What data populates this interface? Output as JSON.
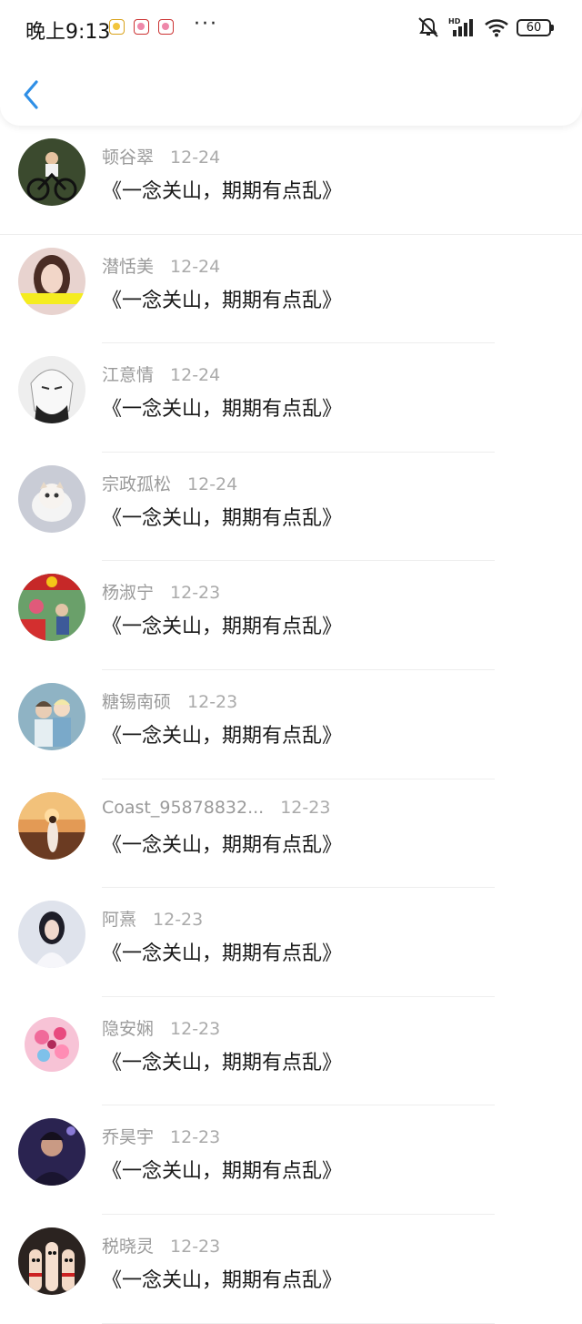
{
  "status_bar": {
    "time": "晚上9:13",
    "dots": "···",
    "battery": "60",
    "network_label": "HD"
  },
  "header": {
    "back_icon": "chevron-left-icon"
  },
  "comments": [
    {
      "name": "顿谷翠",
      "date": "12-24",
      "text": "《一念关山，期期有点乱》"
    },
    {
      "name": "潜恬美",
      "date": "12-24",
      "text": "《一念关山，期期有点乱》"
    },
    {
      "name": "江意情",
      "date": "12-24",
      "text": "《一念关山，期期有点乱》"
    },
    {
      "name": "宗政孤松",
      "date": "12-24",
      "text": "《一念关山，期期有点乱》"
    },
    {
      "name": "杨淑宁",
      "date": "12-23",
      "text": "《一念关山，期期有点乱》"
    },
    {
      "name": "糖锡南硕",
      "date": "12-23",
      "text": "《一念关山，期期有点乱》"
    },
    {
      "name": "Coast_95878832...",
      "date": "12-23",
      "text": "《一念关山，期期有点乱》"
    },
    {
      "name": "阿熹",
      "date": "12-23",
      "text": "《一念关山，期期有点乱》"
    },
    {
      "name": "隐安娴",
      "date": "12-23",
      "text": "《一念关山，期期有点乱》"
    },
    {
      "name": "乔昊宇",
      "date": "12-23",
      "text": "《一念关山，期期有点乱》"
    },
    {
      "name": "税晓灵",
      "date": "12-23",
      "text": "《一念关山，期期有点乱》"
    }
  ],
  "colors": {
    "accent": "#2f8fe6",
    "meta_text": "#9a9a9a"
  }
}
